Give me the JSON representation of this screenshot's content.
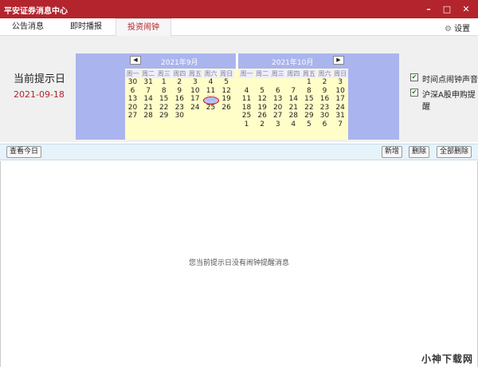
{
  "window": {
    "title": "平安证券消息中心",
    "min": "–",
    "max": "□",
    "close": "✕"
  },
  "tabs": [
    {
      "label": "公告消息"
    },
    {
      "label": "即时播报"
    },
    {
      "label": "投资闹钟",
      "active": true
    }
  ],
  "settings_label": "设置",
  "reminder": {
    "label": "当前提示日",
    "date": "2021-09-18"
  },
  "weekdays": [
    "周一",
    "周二",
    "周三",
    "周四",
    "周五",
    "周六",
    "周日"
  ],
  "calendars": [
    {
      "title": "2021年9月",
      "nav": "◀",
      "rows": [
        [
          "30",
          "31",
          "1",
          "2",
          "3",
          "4",
          "5"
        ],
        [
          "6",
          "7",
          "8",
          "9",
          "10",
          "11",
          "12"
        ],
        [
          "13",
          "14",
          "15",
          "16",
          "17",
          "18",
          "19"
        ],
        [
          "20",
          "21",
          "22",
          "23",
          "24",
          "25",
          "26"
        ],
        [
          "27",
          "28",
          "29",
          "30",
          "",
          "",
          ""
        ]
      ],
      "today": "18"
    },
    {
      "title": "2021年10月",
      "nav": "▶",
      "rows": [
        [
          "",
          "",
          "",
          "",
          "1",
          "2",
          "3"
        ],
        [
          "4",
          "5",
          "6",
          "7",
          "8",
          "9",
          "10"
        ],
        [
          "11",
          "12",
          "13",
          "14",
          "15",
          "16",
          "17"
        ],
        [
          "18",
          "19",
          "20",
          "21",
          "22",
          "23",
          "24"
        ],
        [
          "25",
          "26",
          "27",
          "28",
          "29",
          "30",
          "31"
        ],
        [
          "1",
          "2",
          "3",
          "4",
          "5",
          "6",
          "7"
        ]
      ]
    }
  ],
  "options": [
    {
      "label": "时间点闹钟声音",
      "checked": true
    },
    {
      "label": "沪深A股申购提醒",
      "checked": true
    }
  ],
  "toolbar": {
    "today": "查看今日",
    "add": "新增",
    "delete": "删除",
    "delete_all": "全部删除"
  },
  "empty_message": "您当前提示日没有闹钟提醒消息",
  "watermark": "小神下载网",
  "colors": {
    "titlebar": "#b3242c",
    "calendar": "#aab4ee",
    "calendar_days": "#fffdc8"
  }
}
